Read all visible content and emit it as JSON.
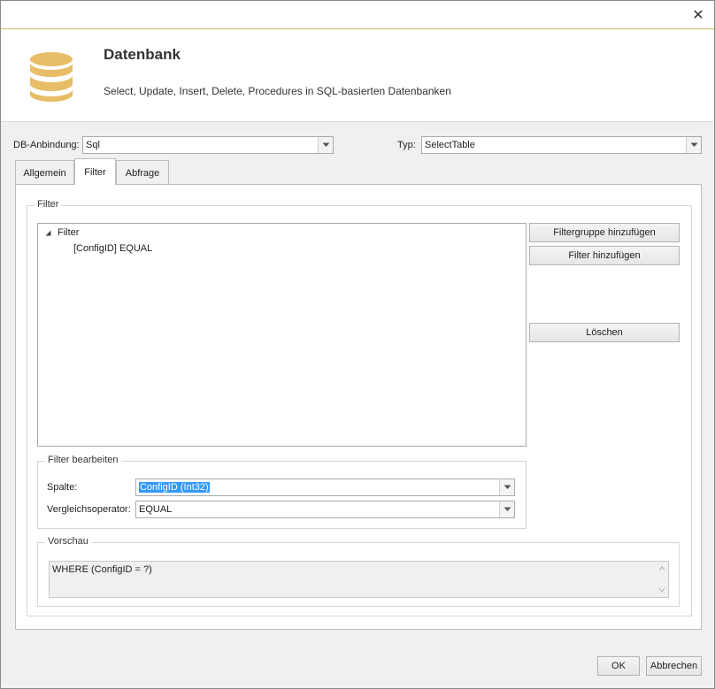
{
  "window": {
    "close_glyph": "✕"
  },
  "header": {
    "title": "Datenbank",
    "description": "Select, Update, Insert, Delete, Procedures in SQL-basierten Datenbanken",
    "icon": "database-icon",
    "icon_color": "#e8bd67"
  },
  "connection": {
    "db_label": "DB-Anbindung:",
    "db_value": "Sql",
    "type_label": "Typ:",
    "type_value": "SelectTable"
  },
  "tabs": [
    {
      "label": "Allgemein",
      "active": false
    },
    {
      "label": "Filter",
      "active": true
    },
    {
      "label": "Abfrage",
      "active": false
    }
  ],
  "filter": {
    "group_title": "Filter",
    "tree": {
      "root_label": "Filter",
      "children": [
        "[ConfigID] EQUAL"
      ]
    },
    "buttons": {
      "add_group": "Filtergruppe hinzufügen",
      "add_filter": "Filter hinzufügen",
      "delete": "Löschen"
    }
  },
  "edit": {
    "group_title": "Filter bearbeiten",
    "column_label": "Spalte:",
    "column_value": "ConfigID (Int32)",
    "operator_label": "Vergleichsoperator:",
    "operator_value": "EQUAL"
  },
  "preview": {
    "group_title": "Vorschau",
    "text": "WHERE (ConfigID  =  ?)"
  },
  "footer": {
    "ok": "OK",
    "cancel": "Abbrechen"
  }
}
